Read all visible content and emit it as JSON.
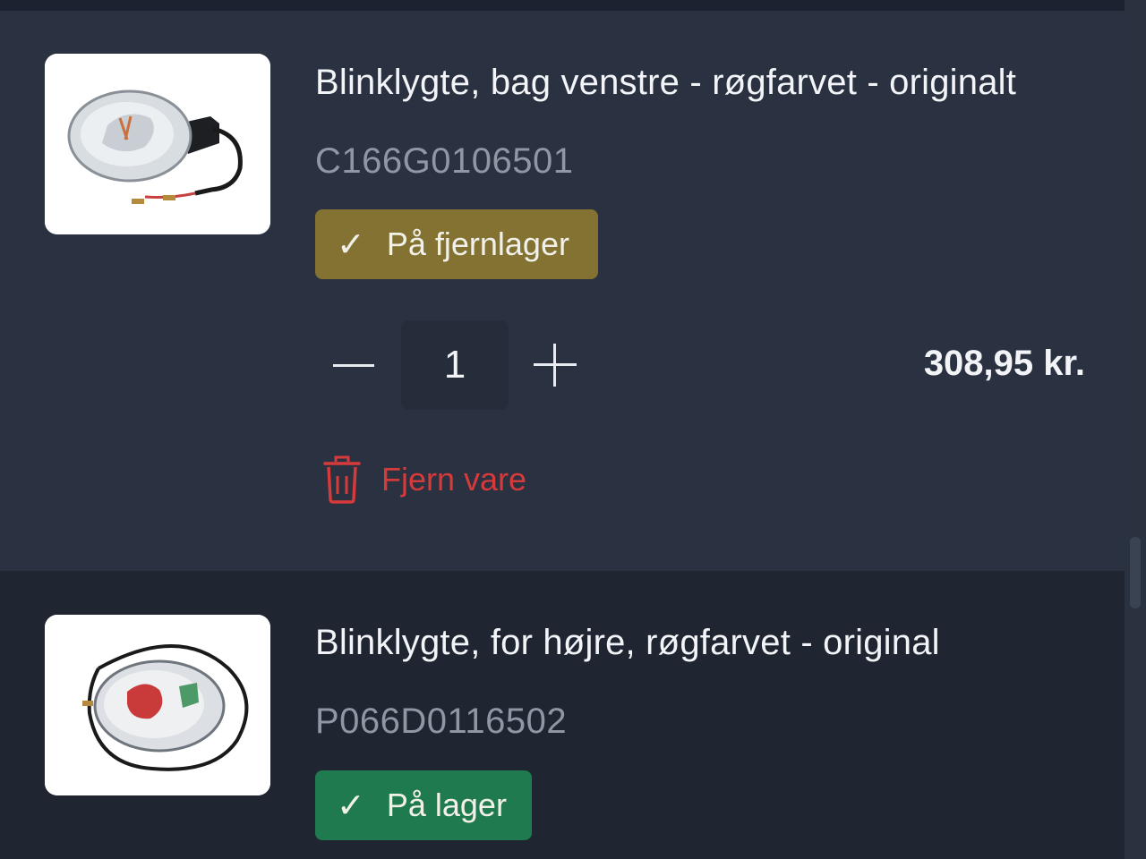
{
  "cart": {
    "items": [
      {
        "title": "Blinklygte, bag venstre - røgfarvet - originalt",
        "sku": "C166G0106501",
        "stock_status": "På fjernlager",
        "stock_color": "#837231",
        "quantity": "1",
        "price": "308,95 kr.",
        "remove_label": "Fjern vare",
        "image_icon": "turn-signal-rear-left-image"
      },
      {
        "title": "Blinklygte, for højre, røgfarvet - original",
        "sku": "P066D0116502",
        "stock_status": "På lager",
        "stock_color": "#1f7a4f",
        "image_icon": "turn-signal-front-right-image"
      }
    ]
  },
  "colors": {
    "background": "#1f2632",
    "item_background": "#2a3140",
    "remove_red": "#d63a3a"
  },
  "icons": {
    "check": "check-icon",
    "minus": "minus-icon",
    "plus": "plus-icon",
    "trash": "trash-icon"
  }
}
